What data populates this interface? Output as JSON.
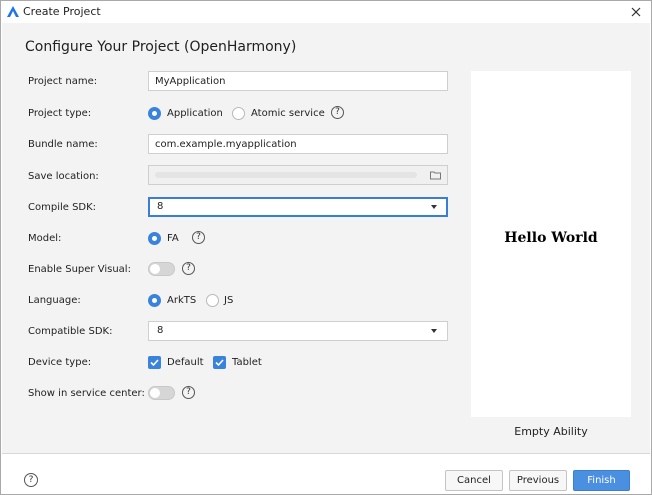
{
  "window": {
    "title": "Create Project"
  },
  "heading": "Configure Your Project (OpenHarmony)",
  "form": {
    "project_name": {
      "label": "Project name:",
      "value": "MyApplication"
    },
    "project_type": {
      "label": "Project type:",
      "options": [
        "Application",
        "Atomic service"
      ],
      "selected": "Application"
    },
    "bundle_name": {
      "label": "Bundle name:",
      "value": "com.example.myapplication"
    },
    "save_location": {
      "label": "Save location:",
      "value": ""
    },
    "compile_sdk": {
      "label": "Compile SDK:",
      "value": "8"
    },
    "model": {
      "label": "Model:",
      "options": [
        "FA"
      ],
      "selected": "FA"
    },
    "super_visual": {
      "label": "Enable Super Visual:",
      "enabled": false
    },
    "language": {
      "label": "Language:",
      "options": [
        "ArkTS",
        "JS"
      ],
      "selected": "ArkTS"
    },
    "compatible_sdk": {
      "label": "Compatible SDK:",
      "value": "8"
    },
    "device_type": {
      "label": "Device type:",
      "options": [
        "Default",
        "Tablet"
      ],
      "checked": [
        "Default",
        "Tablet"
      ]
    },
    "service_center": {
      "label": "Show in service center:",
      "enabled": false
    }
  },
  "help_glyph": "?",
  "preview": {
    "title": "Hello World",
    "caption": "Empty Ability"
  },
  "footer": {
    "cancel": "Cancel",
    "previous": "Previous",
    "finish": "Finish"
  },
  "icons": [
    "app-logo-icon",
    "close-icon",
    "folder-icon",
    "chevron-down-icon",
    "help-icon",
    "checkmark-icon"
  ],
  "colors": {
    "accent": "#3a83dc",
    "primary_button": "#4a8fe0",
    "content_bg": "#f3f3f3"
  }
}
